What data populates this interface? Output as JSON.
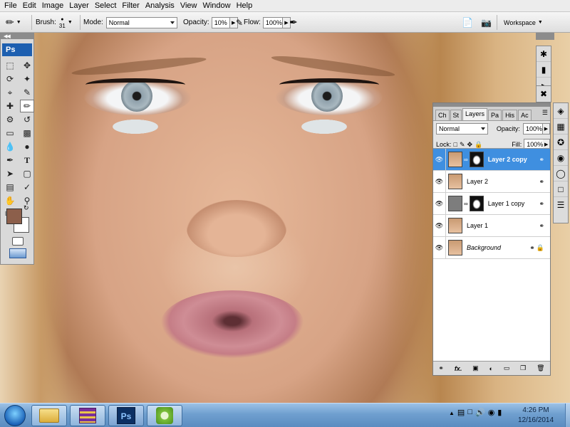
{
  "menu": [
    "File",
    "Edit",
    "Image",
    "Layer",
    "Select",
    "Filter",
    "Analysis",
    "View",
    "Window",
    "Help"
  ],
  "options": {
    "brush_label": "Brush:",
    "brush_size": "31",
    "mode_label": "Mode:",
    "mode_value": "Normal",
    "opacity_label": "Opacity:",
    "opacity_value": "10%",
    "flow_label": "Flow:",
    "flow_value": "100%",
    "workspace_label": "Workspace"
  },
  "tools": {
    "logo": "Ps",
    "foreground_color": "#8c5f4b",
    "background_color": "#ffffff"
  },
  "layers_panel": {
    "tabs": [
      "Ch",
      "St",
      "Layers",
      "Pa",
      "His",
      "Ac"
    ],
    "active_tab": "Layers",
    "blend_mode": "Normal",
    "opacity_label": "Opacity:",
    "opacity_value": "100%",
    "lock_label": "Lock:",
    "fill_label": "Fill:",
    "fill_value": "100%",
    "layers": [
      {
        "name": "Layer 2 copy",
        "selected": true,
        "thumb": "photo",
        "mask": true
      },
      {
        "name": "Layer 2",
        "selected": false,
        "thumb": "photo",
        "mask": false
      },
      {
        "name": "Layer 1 copy",
        "selected": false,
        "thumb": "gray",
        "mask": true
      },
      {
        "name": "Layer 1",
        "selected": false,
        "thumb": "photo",
        "mask": false
      },
      {
        "name": "Background",
        "selected": false,
        "thumb": "photo",
        "mask": false,
        "locked": true
      }
    ],
    "bottom_icons": [
      "link-icon",
      "fx-icon",
      "mask-icon",
      "adjustment-icon",
      "group-icon",
      "new-layer-icon",
      "trash-icon"
    ]
  },
  "taskbar": {
    "time": "4:26 PM",
    "date": "12/16/2014",
    "pinned": [
      "explorer",
      "winrar",
      "photoshop",
      "greenshot"
    ]
  }
}
